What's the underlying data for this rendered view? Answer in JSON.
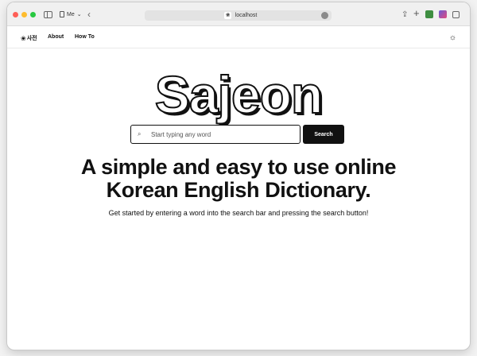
{
  "browser": {
    "profile_label": "Me",
    "url": "localhost"
  },
  "nav": {
    "brand": "사전",
    "links": [
      "About",
      "How To"
    ]
  },
  "main": {
    "logo_text": "Sajeon",
    "search": {
      "placeholder": "Start typing any word",
      "button_label": "Search"
    },
    "headline_line1": "A simple and easy to use online",
    "headline_line2": "Korean English Dictionary.",
    "subtext": "Get started by entering a word into the search bar and pressing the search button!"
  },
  "icons": {
    "brand": "flower-icon",
    "search": "search-icon",
    "theme": "sun-icon"
  },
  "colors": {
    "primary": "#111111",
    "background": "#ffffff"
  }
}
